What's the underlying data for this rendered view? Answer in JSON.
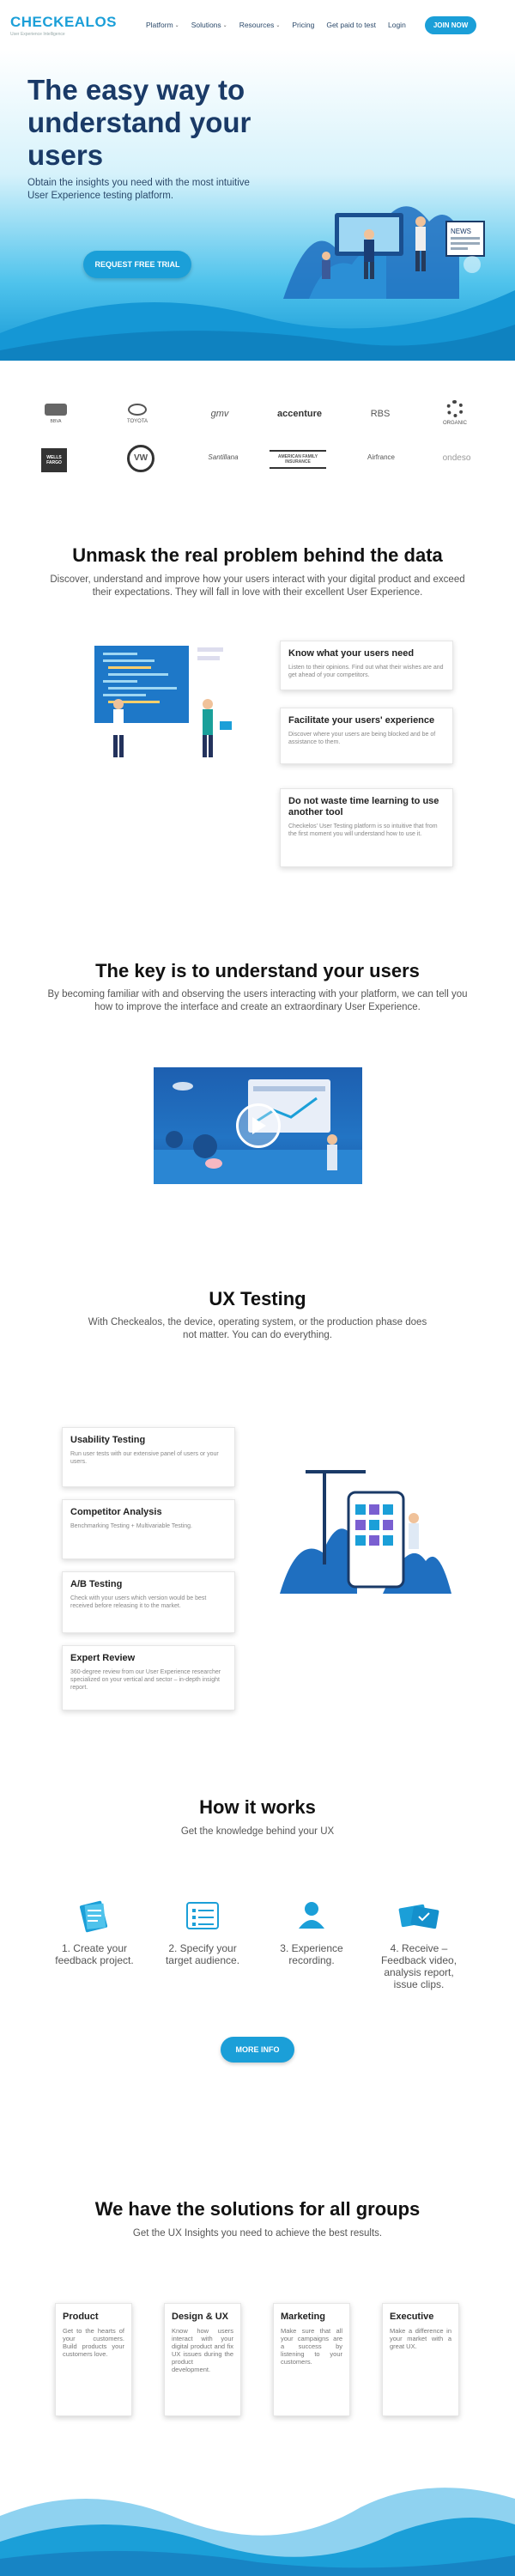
{
  "nav": {
    "logo": "CHECKEALOS",
    "logo_tagline": "User Experience Intelligence",
    "items": [
      {
        "label": "Platform",
        "has_dropdown": true
      },
      {
        "label": "Solutions",
        "has_dropdown": true
      },
      {
        "label": "Resources",
        "has_dropdown": true
      },
      {
        "label": "Pricing",
        "has_dropdown": false
      },
      {
        "label": "Get paid to test",
        "has_dropdown": false
      },
      {
        "label": "Login",
        "has_dropdown": false
      }
    ],
    "join_label": "JOIN NOW"
  },
  "hero": {
    "title": "The easy way to understand your users",
    "subtitle": "Obtain the insights you need with the most intuitive User Experience testing platform.",
    "cta": "REQUEST FREE TRIAL",
    "news_sign": "NEWS"
  },
  "clients": [
    "BBVA",
    "TOYOTA",
    "gmv",
    "accenture",
    "RBS",
    "ORGANIC",
    "WELLS FARGO",
    "VW",
    "Santillana",
    "AMERICAN FAMILY INSURANCE",
    "Airfrance",
    "ondeso"
  ],
  "section1": {
    "title": "Unmask the real problem behind the data",
    "subtitle": "Discover, understand and improve how your users interact with your digital product and exceed their expectations. They will fall in love with their excellent User Experience.",
    "cards": [
      {
        "title": "Know what your users need",
        "text": "Listen to their opinions. Find out what their wishes are and get ahead of your competitors."
      },
      {
        "title": "Facilitate your users' experience",
        "text": "Discover where your users are being blocked and be of assistance to them."
      },
      {
        "title": "Do not waste time learning to use another tool",
        "text": "Checkelos' User Testing platform is so intuitive that from the first moment you will understand how to use it."
      }
    ]
  },
  "section2": {
    "title": "The key is to understand your users",
    "subtitle": "By becoming familiar with and observing the users interacting with your platform, we can tell you how to improve the interface and create an extraordinary User Experience."
  },
  "section3": {
    "title": "UX Testing",
    "subtitle": "With Checkealos, the device, operating system, or the production phase does not matter. You can do everything.",
    "cards": [
      {
        "title": "Usability Testing",
        "text": "Run user tests with our extensive panel of users or your users."
      },
      {
        "title": "Competitor Analysis",
        "text": "Benchmarking Testing + Multivariable Testing."
      },
      {
        "title": "A/B Testing",
        "text": "Check with your users which version would be best received before releasing it to the market."
      },
      {
        "title": "Expert Review",
        "text": "360-degree review from our User Experience researcher specialized on your vertical and sector – in-depth insight report."
      }
    ]
  },
  "section4": {
    "title": "How it works",
    "subtitle": "Get the knowledge behind your UX",
    "steps": [
      {
        "label": "1. Create your feedback project."
      },
      {
        "label": "2. Specify your target audience."
      },
      {
        "label": "3. Experience recording."
      },
      {
        "label": "4. Receive – Feedback video, analysis report, issue clips."
      }
    ],
    "cta": "MORE INFO"
  },
  "section5": {
    "title": "We have the solutions for all groups",
    "subtitle": "Get the UX Insights you need to achieve the best results.",
    "cards": [
      {
        "title": "Product",
        "text": "Get to the hearts of your customers. Build products your customers love."
      },
      {
        "title": "Design & UX",
        "text": "Know how users interact with your digital product and fix UX issues during the product development."
      },
      {
        "title": "Marketing",
        "text": "Make sure that all your campaigns are a success by listening to your customers."
      },
      {
        "title": "Executive",
        "text": "Make a difference in your market with a great UX."
      }
    ]
  },
  "colors": {
    "accent": "#1b9fd8",
    "heading": "#1a3a67",
    "hero_bottom": "#1597d5"
  }
}
